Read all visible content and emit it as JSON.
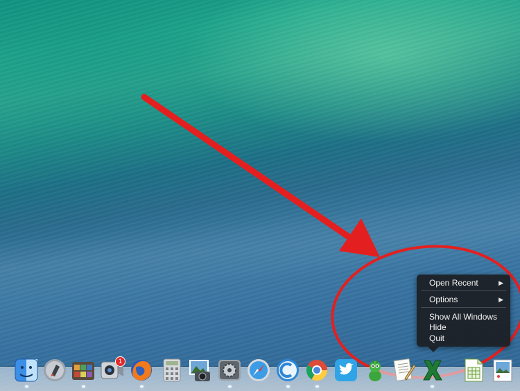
{
  "context_menu": {
    "app": "Microsoft Excel",
    "items": [
      {
        "label": "Open Recent",
        "submenu": true
      },
      {
        "label": "Options",
        "submenu": true
      },
      {
        "label": "Show All Windows",
        "submenu": false
      },
      {
        "label": "Hide",
        "submenu": false
      },
      {
        "label": "Quit",
        "submenu": false
      }
    ]
  },
  "annotation": {
    "arrow_color": "#e3201f",
    "circle_color": "#e3201f"
  },
  "dock": {
    "apps": [
      {
        "name": "Finder",
        "icon": "finder-icon"
      },
      {
        "name": "Launchpad",
        "icon": "launchpad-icon"
      },
      {
        "name": "Photo Booth Gallery",
        "icon": "app-switcher-icon"
      },
      {
        "name": "FaceTime",
        "icon": "facetime-icon",
        "badge": "1"
      },
      {
        "name": "Firefox",
        "icon": "firefox-icon"
      },
      {
        "name": "Calculator",
        "icon": "calculator-icon"
      },
      {
        "name": "Image Capture",
        "icon": "image-capture-icon"
      },
      {
        "name": "System Preferences",
        "icon": "system-preferences-icon"
      },
      {
        "name": "Safari",
        "icon": "safari-icon"
      },
      {
        "name": "Cloud App",
        "icon": "cloud-app-icon"
      },
      {
        "name": "Chrome",
        "icon": "chrome-icon"
      },
      {
        "name": "Twitter",
        "icon": "twitter-icon"
      },
      {
        "name": "Adium",
        "icon": "adium-icon"
      },
      {
        "name": "TextEdit",
        "icon": "textedit-icon"
      },
      {
        "name": "Microsoft Excel",
        "icon": "excel-icon"
      },
      {
        "name": "LibreOffice Calc",
        "icon": "libreoffice-calc-icon"
      },
      {
        "name": "Preview",
        "icon": "preview-icon"
      }
    ]
  }
}
